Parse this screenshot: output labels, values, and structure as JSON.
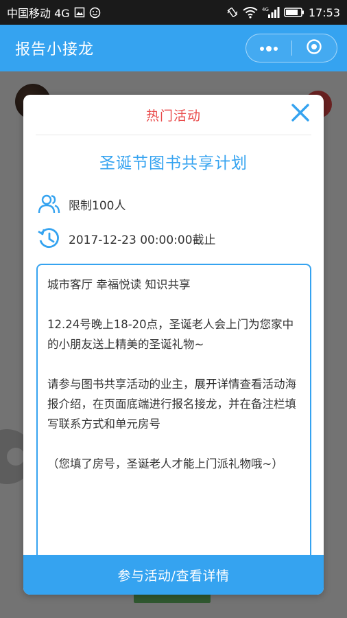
{
  "status_bar": {
    "carrier": "中国移动 4G",
    "network": "4G",
    "time": "17:53",
    "icons": [
      "gallery-icon",
      "smiley-icon",
      "vibrate-icon",
      "wifi-icon",
      "signal-icon",
      "battery-icon"
    ]
  },
  "title_bar": {
    "title": "报告小接龙",
    "capsule_icons": [
      "more-dots-icon",
      "close-circle-icon"
    ]
  },
  "modal": {
    "header_title": "热门活动",
    "activity_title": "圣诞节图书共享计划",
    "limit_text": "限制100人",
    "deadline_text": "2017-12-23 00:00:00截止",
    "description": {
      "line1": "城市客厅 幸福悦读 知识共享",
      "para2": "12.24号晚上18-20点，圣诞老人会上门为您家中的小朋友送上精美的圣诞礼物~",
      "para3": "请参与图书共享活动的业主，展开详情查看活动海报介绍，在页面底端进行报名接龙，并在备注栏填写联系方式和单元房号",
      "para4": "（您填了房号，圣诞老人才能上门派礼物哦~）"
    },
    "join_button": "参与活动/查看详情"
  },
  "colors": {
    "accent": "#35a3f0",
    "header_title": "#e94b4b",
    "text": "#333333"
  }
}
